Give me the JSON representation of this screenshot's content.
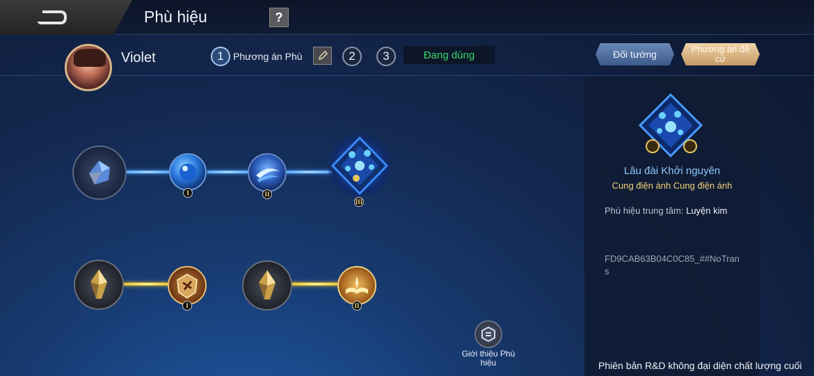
{
  "header": {
    "title": "Phù hiệu",
    "help_label": "?"
  },
  "hero": {
    "name": "Violet"
  },
  "plans": {
    "items": [
      {
        "number": "1",
        "active": true
      },
      {
        "number": "2",
        "active": false
      },
      {
        "number": "3",
        "active": false
      }
    ],
    "active_name": "Phương án Phù",
    "status": "Đang dùng"
  },
  "buttons": {
    "target": "Đối tướng",
    "suggested": "Phương án đề cử"
  },
  "tree": {
    "branch_top": {
      "color": "blue",
      "nodes": [
        {
          "name": "top-root",
          "tier": ""
        },
        {
          "name": "top-tier-1",
          "tier": "I"
        },
        {
          "name": "top-tier-2",
          "tier": "II"
        },
        {
          "name": "top-tier-3",
          "tier": "III"
        }
      ]
    },
    "branch_bottom": {
      "color": "gold",
      "nodes": [
        {
          "name": "bottom-a-root",
          "tier": ""
        },
        {
          "name": "bottom-a-tier-1",
          "tier": "I"
        },
        {
          "name": "bottom-b-root",
          "tier": ""
        },
        {
          "name": "bottom-b-tier-2",
          "tier": "II"
        }
      ]
    }
  },
  "intro": {
    "label": "Giới thiệu Phù hiệu"
  },
  "detail": {
    "title": "Lâu đài Khởi nguyên",
    "subtitle": "Cung điện ánh  Cung điện ánh",
    "core_label": "Phù hiệu trung tâm:",
    "core_value": "Luyện kim",
    "code": "FD9CAB63B04C0C85_##NoTrans"
  },
  "footer": {
    "note": "Phiên bản R&D không đại diện chất lượng cuối"
  },
  "colors": {
    "blue_link": "#5aa8ff",
    "gold_link": "#e8c030",
    "status_green": "#39d86a",
    "detail_title": "#8ec8ff",
    "detail_subtitle": "#f2d27a"
  }
}
